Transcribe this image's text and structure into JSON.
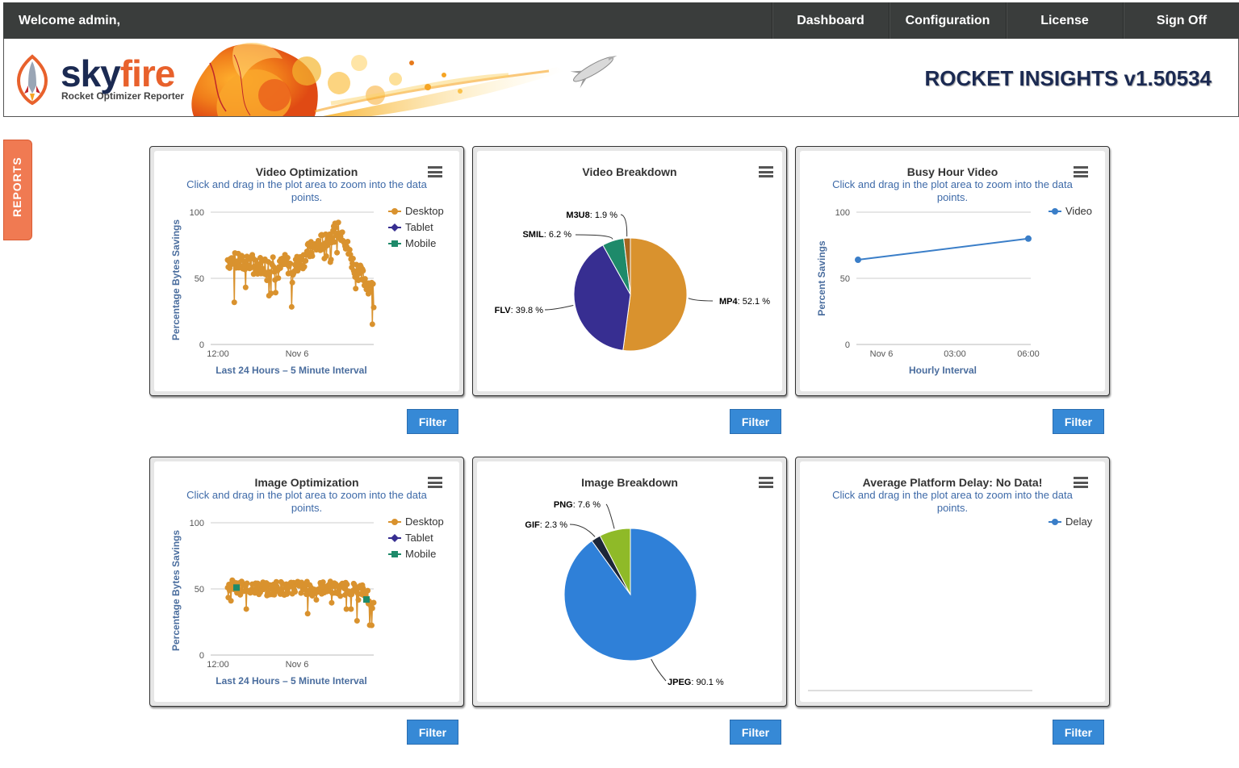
{
  "topbar": {
    "welcome": "Welcome admin,",
    "nav": [
      "Dashboard",
      "Configuration",
      "License",
      "Sign Off"
    ]
  },
  "header": {
    "brand_sky": "sky",
    "brand_fire": "fire",
    "brand_sub": "Rocket Optimizer Reporter",
    "version": "ROCKET INSIGHTS v1.50534"
  },
  "side_tab": "REPORTS",
  "hint": "Click and drag in the plot area to zoom into the data points.",
  "panels": {
    "video_opt": {
      "title": "Video Optimization",
      "ylabel": "Percentage Bytes Savings",
      "xlabel": "Last 24 Hours – 5 Minute Interval",
      "xticks": [
        "12:00",
        "Nov 6"
      ],
      "yticks": [
        "100",
        "50",
        "0"
      ],
      "legend": [
        "Desktop",
        "Tablet",
        "Mobile"
      ]
    },
    "video_break": {
      "title": "Video Breakdown"
    },
    "busy_video": {
      "title": "Busy Hour Video",
      "ylabel": "Percent Savings",
      "xlabel": "Hourly Interval",
      "xticks": [
        "Nov 6",
        "03:00",
        "06:00"
      ],
      "yticks": [
        "100",
        "50",
        "0"
      ],
      "legend": [
        "Video"
      ]
    },
    "image_opt": {
      "title": "Image Optimization",
      "ylabel": "Percentage Bytes Savings",
      "xlabel": "Last 24 Hours – 5 Minute Interval",
      "xticks": [
        "12:00",
        "Nov 6"
      ],
      "yticks": [
        "100",
        "50",
        "0"
      ],
      "legend": [
        "Desktop",
        "Tablet",
        "Mobile"
      ]
    },
    "image_break": {
      "title": "Image Breakdown"
    },
    "platform_delay": {
      "title": "Average Platform Delay: No Data!",
      "legend": [
        "Delay"
      ]
    }
  },
  "filter_label": "Filter",
  "colors": {
    "desktop": "#d9922e",
    "tablet": "#372e91",
    "mobile": "#1e8a6a",
    "video": "#3a7ec8",
    "jpeg": "#2f80d8",
    "gif": "#1c2638",
    "png": "#8fba28",
    "mp4": "#d9922e",
    "flv": "#372e91",
    "smil": "#1e8a6a",
    "m3u8": "#a5661f"
  },
  "chart_data": [
    {
      "type": "scatter",
      "title": "Video Optimization",
      "ylabel": "Percentage Bytes Savings",
      "xlabel": "Last 24 Hours – 5 Minute Interval",
      "ylim": [
        0,
        100
      ],
      "series": [
        {
          "name": "Desktop",
          "trend": [
            64,
            63,
            62,
            61,
            60,
            62,
            59,
            61,
            58,
            63,
            55,
            62,
            60,
            57,
            62,
            64,
            70,
            72,
            75,
            78,
            80,
            84,
            86,
            84,
            70,
            60,
            55,
            50,
            45,
            40
          ]
        },
        {
          "name": "Tablet",
          "values": []
        },
        {
          "name": "Mobile",
          "values": []
        }
      ]
    },
    {
      "type": "pie",
      "title": "Video Breakdown",
      "slices": [
        {
          "label": "MP4",
          "value": 52.1
        },
        {
          "label": "FLV",
          "value": 39.8
        },
        {
          "label": "SMIL",
          "value": 6.2
        },
        {
          "label": "M3U8",
          "value": 1.9
        }
      ]
    },
    {
      "type": "line",
      "title": "Busy Hour Video",
      "ylabel": "Percent Savings",
      "xlabel": "Hourly Interval",
      "ylim": [
        0,
        100
      ],
      "series": [
        {
          "name": "Video",
          "values": [
            64,
            80
          ]
        }
      ]
    },
    {
      "type": "scatter",
      "title": "Image Optimization",
      "ylabel": "Percentage Bytes Savings",
      "xlabel": "Last 24 Hours – 5 Minute Interval",
      "ylim": [
        0,
        100
      ],
      "series": [
        {
          "name": "Desktop",
          "trend": [
            53,
            52,
            50,
            51,
            49,
            52,
            50,
            51,
            49,
            50,
            52,
            50,
            49,
            51,
            52,
            50,
            51,
            49,
            50,
            51,
            52,
            50,
            49,
            50,
            51,
            50,
            49,
            48,
            45,
            35
          ]
        },
        {
          "name": "Tablet",
          "values": []
        },
        {
          "name": "Mobile",
          "values": [
            51,
            42
          ]
        }
      ]
    },
    {
      "type": "pie",
      "title": "Image Breakdown",
      "slices": [
        {
          "label": "JPEG",
          "value": 90.1
        },
        {
          "label": "GIF",
          "value": 2.3
        },
        {
          "label": "PNG",
          "value": 7.6
        }
      ]
    },
    {
      "type": "line",
      "title": "Average Platform Delay: No Data!",
      "series": [
        {
          "name": "Delay",
          "values": []
        }
      ]
    }
  ]
}
